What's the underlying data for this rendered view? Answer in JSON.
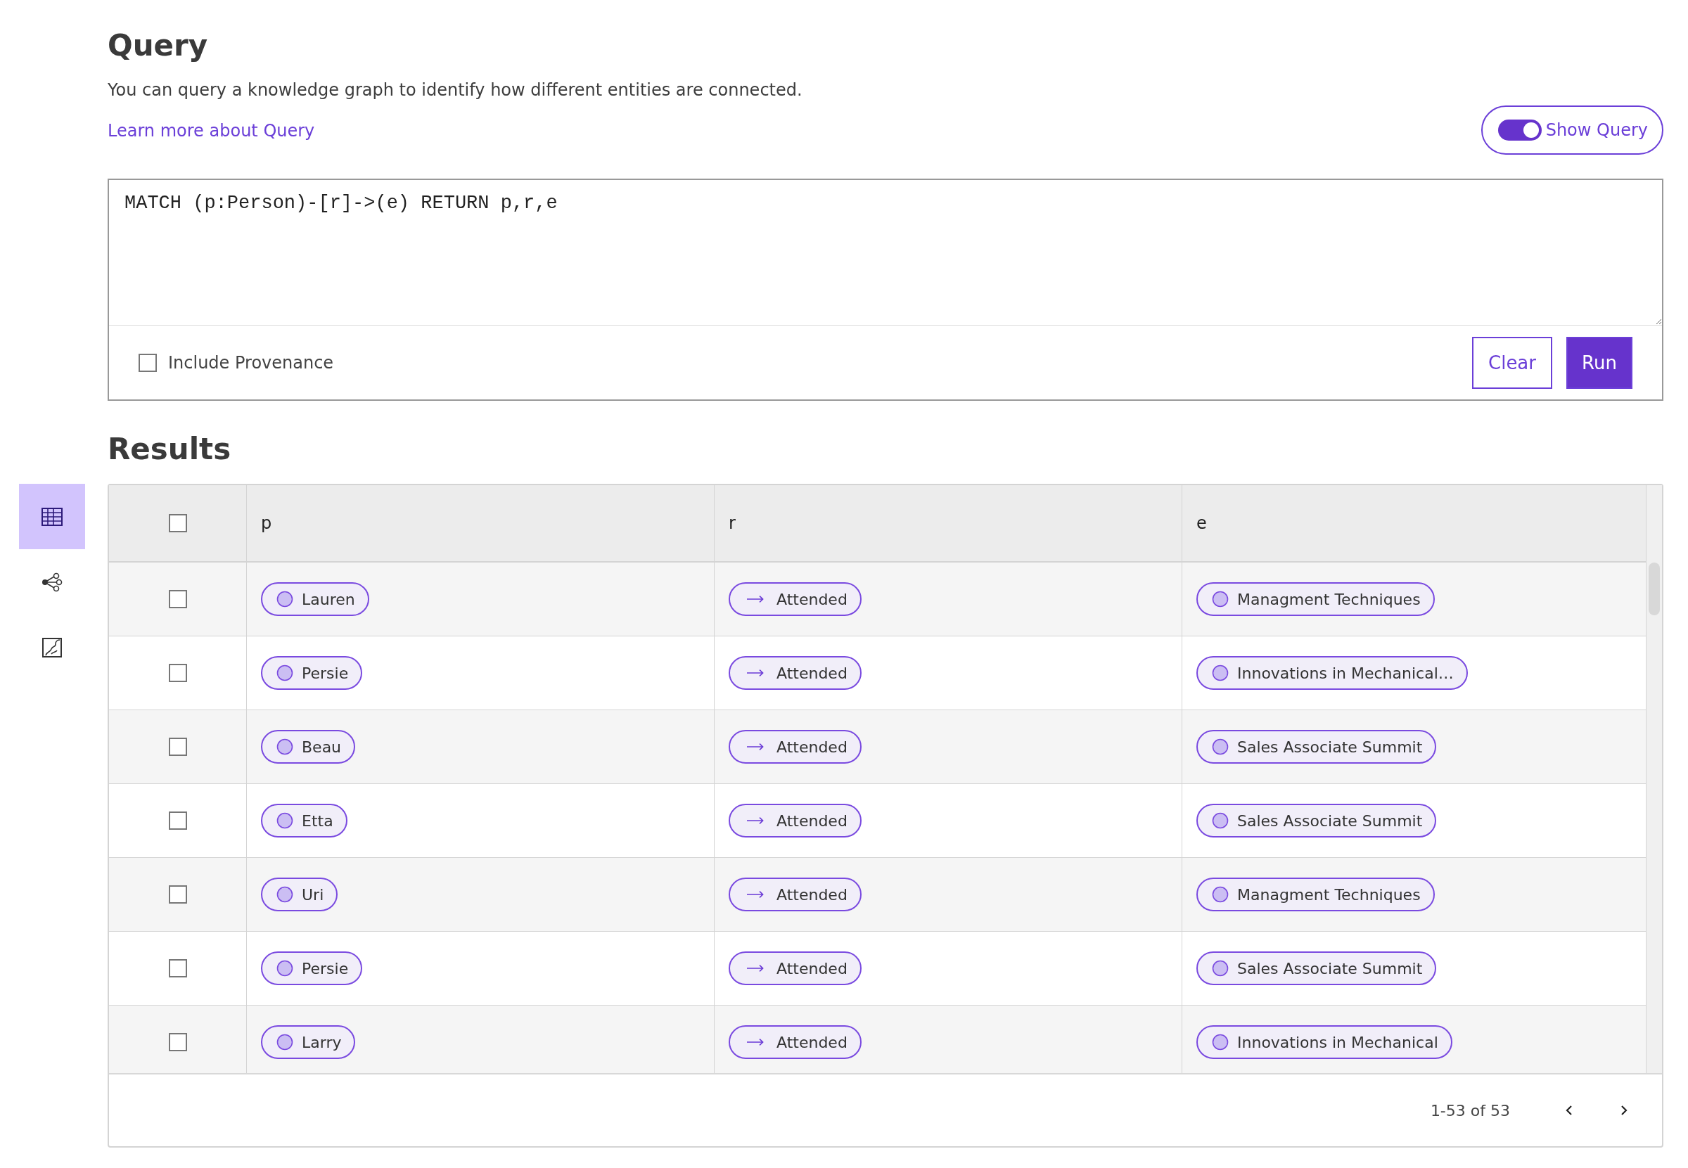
{
  "title": "Query",
  "description": "You can query a knowledge graph to identify how different entities are connected.",
  "learn_more_link": "Learn more about Query",
  "show_query_toggle": {
    "label": "Show Query",
    "on": true
  },
  "query_editor": {
    "value": "MATCH (p:Person)-[r]->(e) RETURN p,r,e",
    "include_provenance": {
      "label": "Include Provenance",
      "checked": false
    },
    "buttons": [
      {
        "label": "Clear",
        "kind": "secondary"
      },
      {
        "label": "Run",
        "kind": "primary"
      }
    ]
  },
  "results_title": "Results",
  "view_switcher": [
    {
      "kind": "table",
      "selected": true
    },
    {
      "kind": "graph",
      "selected": false
    },
    {
      "kind": "map",
      "selected": false
    }
  ],
  "table": {
    "select_all_checked": false,
    "columns": [
      {
        "label": "p",
        "kind": "entity"
      },
      {
        "label": "r",
        "kind": "relationship"
      },
      {
        "label": "e",
        "kind": "entity"
      }
    ],
    "rows": [
      {
        "checked": false,
        "cells": [
          "Lauren",
          "Attended",
          "Managment Techniques"
        ]
      },
      {
        "checked": false,
        "cells": [
          "Persie",
          "Attended",
          "Innovations in Mechanical…"
        ]
      },
      {
        "checked": false,
        "cells": [
          "Beau",
          "Attended",
          "Sales Associate Summit"
        ]
      },
      {
        "checked": false,
        "cells": [
          "Etta",
          "Attended",
          "Sales Associate Summit"
        ]
      },
      {
        "checked": false,
        "cells": [
          "Uri",
          "Attended",
          "Managment Techniques"
        ]
      },
      {
        "checked": false,
        "cells": [
          "Persie",
          "Attended",
          "Sales Associate Summit"
        ]
      },
      {
        "checked": false,
        "cells": [
          "Larry",
          "Attended",
          "Innovations in Mechanical"
        ]
      }
    ],
    "pagination": "1-53 of 53"
  }
}
